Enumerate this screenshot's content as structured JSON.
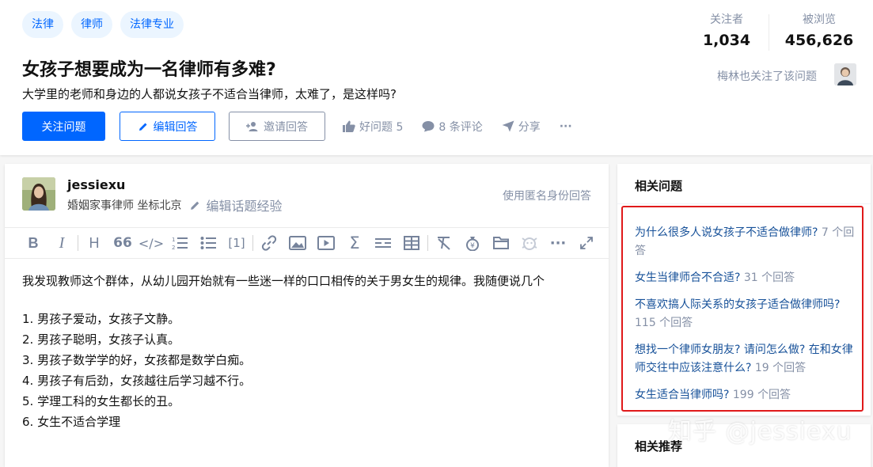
{
  "question": {
    "tags": [
      "法律",
      "律师",
      "法律专业"
    ],
    "title": "女孩子想要成为一名律师有多难?",
    "description": "大学里的老师和身边的人都说女孩子不适合当律师，太难了，是这样吗?",
    "follow_button": "关注问题",
    "edit_answer_button": "编辑回答",
    "invite_button": "邀请回答",
    "good_question": "好问题 5",
    "comments": "8 条评论",
    "share": "分享",
    "more": "···"
  },
  "stats": {
    "followers_label": "关注者",
    "followers_value": "1,034",
    "views_label": "被浏览",
    "views_value": "456,626",
    "followed_note": "梅林也关注了该问题"
  },
  "editor": {
    "author_name": "jessiexu",
    "author_bio": "婚姻家事律师 坐标北京",
    "edit_experience": "编辑话题经验",
    "anonymous": "使用匿名身份回答",
    "toolbar": [
      "B",
      "I",
      "H",
      "66",
      "</>",
      "ordered-list",
      "bullet-list",
      "[1]",
      "link",
      "image",
      "video",
      "formula",
      "divider",
      "table",
      "clear-format",
      "reward",
      "folder",
      "mascot",
      "···",
      "expand"
    ],
    "content_para": "我发现教师这个群体，从幼儿园开始就有一些迷一样的口口相传的关于男女生的规律。我随便说几个",
    "content_list": [
      "1. 男孩子爱动，女孩子文静。",
      "2. 男孩子聪明，女孩子认真。",
      "3. 男孩子数学学的好，女孩都是数学白痴。",
      "4. 男孩子有后劲，女孩越往后学习越不行。",
      "5. 学理工科的女生都长的丑。",
      "6. 女生不适合学理"
    ]
  },
  "sidebar": {
    "related_title": "相关问题",
    "related": [
      {
        "title": "为什么很多人说女孩子不适合做律师?",
        "count": "7 个回答"
      },
      {
        "title": "女生当律师合不合适?",
        "count": "31 个回答"
      },
      {
        "title": "不喜欢搞人际关系的女孩子适合做律师吗?",
        "count": "115 个回答"
      },
      {
        "title": "想找一个律师女朋友? 请问怎么做? 在和女律师交往中应该注意什么?",
        "count": "19 个回答"
      },
      {
        "title": "女生适合当律师吗?",
        "count": "199 个回答"
      }
    ],
    "recommend_title": "相关推荐"
  },
  "watermark": "知乎 @jessiexu",
  "colors": {
    "accent": "#0066ff",
    "link": "#175199",
    "muted": "#8590a6",
    "highlight_border": "#e0191a"
  }
}
